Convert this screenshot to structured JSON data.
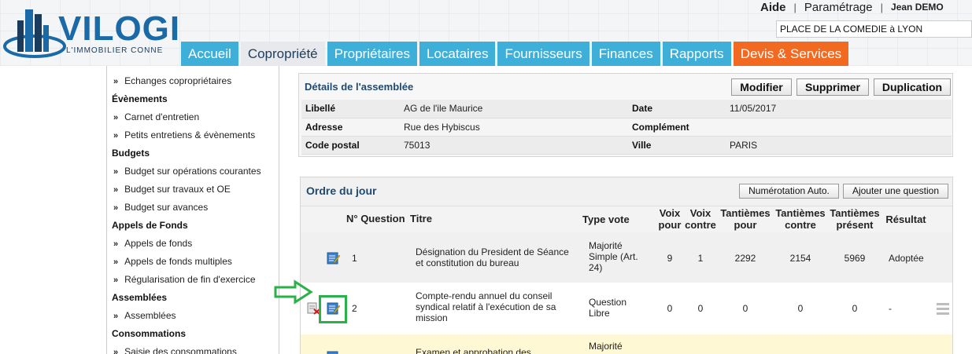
{
  "header": {
    "brand": "VILOGI",
    "tagline": "L'IMMOBILIER CONNE",
    "links": {
      "help": "Aide",
      "settings": "Paramétrage",
      "user": "Jean DEMO"
    },
    "coproperty_select": "PLACE DE LA COMEDIE à LYON",
    "nav": [
      "Accueil",
      "Copropriété",
      "Propriétaires",
      "Locataires",
      "Fournisseurs",
      "Finances",
      "Rapports",
      "Devis & Services"
    ],
    "nav_active": "Copropriété",
    "colors": {
      "tab": "#3eafd8",
      "tab_active": "#e7e9ec",
      "tab_accent": "#f26a22",
      "brand": "#1b6aa8"
    }
  },
  "sidebar": {
    "items": [
      {
        "type": "item",
        "label": "Echanges copropriétaires"
      },
      {
        "type": "section",
        "label": "Évènements"
      },
      {
        "type": "item",
        "label": "Carnet d'entretien"
      },
      {
        "type": "item",
        "label": "Petits entretiens & évènements"
      },
      {
        "type": "section",
        "label": "Budgets"
      },
      {
        "type": "item",
        "label": "Budget sur opérations courantes"
      },
      {
        "type": "item",
        "label": "Budget sur travaux et OE"
      },
      {
        "type": "item",
        "label": "Budget sur avances"
      },
      {
        "type": "section",
        "label": "Appels de Fonds"
      },
      {
        "type": "item",
        "label": "Appels de fonds"
      },
      {
        "type": "item",
        "label": "Appels de fonds multiples"
      },
      {
        "type": "item",
        "label": "Régularisation de fin d'exercice"
      },
      {
        "type": "section",
        "label": "Assemblées"
      },
      {
        "type": "item",
        "label": "Assemblées"
      },
      {
        "type": "section",
        "label": "Consommations"
      },
      {
        "type": "item",
        "label": "Saisie des consommations"
      }
    ],
    "chevron": "»"
  },
  "details": {
    "title": "Détails de l'assemblée",
    "buttons": {
      "edit": "Modifier",
      "delete": "Supprimer",
      "duplicate": "Duplication"
    },
    "fields": {
      "libelle_label": "Libellé",
      "libelle": "AG de l'ile Maurice",
      "date_label": "Date",
      "date": "11/05/2017",
      "adresse_label": "Adresse",
      "adresse": "Rue des Hybiscus",
      "complement_label": "Complément",
      "complement": "",
      "code_postal_label": "Code postal",
      "code_postal": "75013",
      "ville_label": "Ville",
      "ville": "PARIS"
    }
  },
  "agenda": {
    "title": "Ordre du jour",
    "buttons": {
      "auto_number": "Numérotation Auto.",
      "add_question": "Ajouter une question"
    },
    "columns": {
      "num": "N° Question",
      "title": "Titre",
      "vote_type": "Type vote",
      "voix_pour_1": "Voix",
      "voix_pour_2": "pour",
      "voix_contre_1": "Voix",
      "voix_contre_2": "contre",
      "tant_pour_1": "Tantièmes",
      "tant_pour_2": "pour",
      "tant_contre_1": "Tantièmes",
      "tant_contre_2": "contre",
      "tant_present_1": "Tantièmes",
      "tant_present_2": "présent",
      "result": "Résultat"
    },
    "rows": [
      {
        "num": "1",
        "title": "Désignation du President de Séance et constitution du bureau",
        "vote_type": "Majorité Simple (Art. 24)",
        "voix_pour": "9",
        "voix_contre": "1",
        "tant_pour": "2292",
        "tant_contre": "2154",
        "tant_present": "5969",
        "result": "Adoptée"
      },
      {
        "num": "2",
        "title": "Compte-rendu annuel du conseil syndical relatif à l'exécution de sa mission",
        "vote_type": "Question Libre",
        "voix_pour": "0",
        "voix_contre": "0",
        "tant_pour": "0",
        "tant_contre": "0",
        "tant_present": "0",
        "result": "-"
      },
      {
        "num": "",
        "title": "Examen et approbation des",
        "vote_type": "Majorité",
        "voix_pour": "",
        "voix_contre": "",
        "tant_pour": "",
        "tant_contre": "",
        "tant_present": "",
        "result": ""
      }
    ]
  },
  "annotation": {
    "color": "#2bb14a"
  }
}
